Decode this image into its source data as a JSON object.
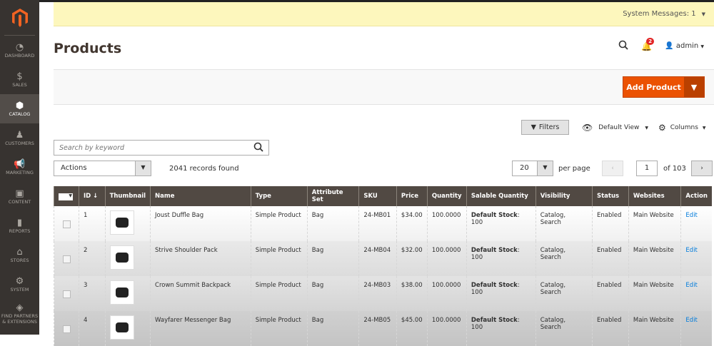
{
  "sidebar": {
    "items": [
      {
        "label": "DASHBOARD",
        "icon": "dashboard-icon",
        "glyph": "◔"
      },
      {
        "label": "SALES",
        "icon": "dollar-icon",
        "glyph": "$"
      },
      {
        "label": "CATALOG",
        "icon": "box-icon",
        "glyph": "⬢",
        "active": true
      },
      {
        "label": "CUSTOMERS",
        "icon": "person-icon",
        "glyph": "♟"
      },
      {
        "label": "MARKETING",
        "icon": "megaphone-icon",
        "glyph": "📢"
      },
      {
        "label": "CONTENT",
        "icon": "layout-icon",
        "glyph": "▣"
      },
      {
        "label": "REPORTS",
        "icon": "bar-chart-icon",
        "glyph": "▮"
      },
      {
        "label": "STORES",
        "icon": "store-icon",
        "glyph": "⌂"
      },
      {
        "label": "SYSTEM",
        "icon": "gear-icon",
        "glyph": "⚙"
      },
      {
        "label": "FIND PARTNERS & EXTENSIONS",
        "icon": "blocks-icon",
        "glyph": "◈"
      }
    ]
  },
  "system_messages": "System Messages: 1",
  "page_title": "Products",
  "header": {
    "notifications": "2",
    "user": "admin"
  },
  "add_product": "Add Product",
  "toolbar": {
    "filters": "Filters",
    "view": "Default View",
    "columns": "Columns",
    "search_placeholder": "Search by keyword",
    "actions": "Actions",
    "records": "2041 records found",
    "per_page_value": "20",
    "per_page_label": "per page",
    "page": "1",
    "of_pages": "of 103"
  },
  "table": {
    "headers": [
      "ID ↓",
      "Thumbnail",
      "Name",
      "Type",
      "Attribute Set",
      "SKU",
      "Price",
      "Quantity",
      "Salable Quantity",
      "Visibility",
      "Status",
      "Websites",
      "Action"
    ],
    "rows": [
      {
        "id": "1",
        "name": "Joust Duffle Bag",
        "type": "Simple Product",
        "attr": "Bag",
        "sku": "24-MB01",
        "price": "$34.00",
        "qty": "100.0000",
        "salable_label": "Default Stock",
        "salable": ": 100",
        "visibility": "Catalog, Search",
        "status": "Enabled",
        "website": "Main Website",
        "action": "Edit"
      },
      {
        "id": "2",
        "name": "Strive Shoulder Pack",
        "type": "Simple Product",
        "attr": "Bag",
        "sku": "24-MB04",
        "price": "$32.00",
        "qty": "100.0000",
        "salable_label": "Default Stock",
        "salable": ": 100",
        "visibility": "Catalog, Search",
        "status": "Enabled",
        "website": "Main Website",
        "action": "Edit"
      },
      {
        "id": "3",
        "name": "Crown Summit Backpack",
        "type": "Simple Product",
        "attr": "Bag",
        "sku": "24-MB03",
        "price": "$38.00",
        "qty": "100.0000",
        "salable_label": "Default Stock",
        "salable": ": 100",
        "visibility": "Catalog, Search",
        "status": "Enabled",
        "website": "Main Website",
        "action": "Edit"
      },
      {
        "id": "4",
        "name": "Wayfarer Messenger Bag",
        "type": "Simple Product",
        "attr": "Bag",
        "sku": "24-MB05",
        "price": "$45.00",
        "qty": "100.0000",
        "salable_label": "Default Stock",
        "salable": ": 100",
        "visibility": "Catalog, Search",
        "status": "Enabled",
        "website": "Main Website",
        "action": "Edit"
      }
    ]
  }
}
